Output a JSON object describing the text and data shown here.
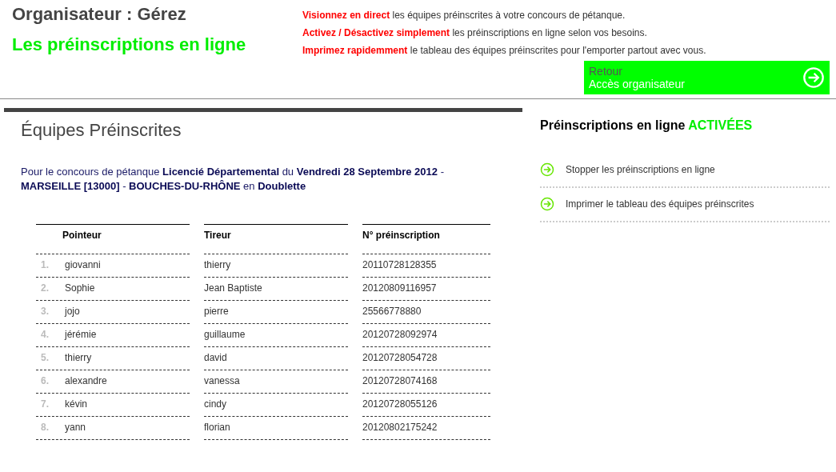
{
  "header": {
    "title": "Organisateur : Gérez",
    "subtitle": "Les préinscriptions en ligne",
    "features": [
      "**Visionnez en direct** les équipes préinscrites à votre concours de pétanque.",
      "**Activez / Désactivez simplement** les préinscriptions en ligne selon vos besoins.",
      "**Imprimez rapidemment** le tableau des équipes préinscrites pour l'emporter partout avec vous."
    ],
    "back_button": {
      "line1": "Retour",
      "line2": "Accès organisateur"
    }
  },
  "main": {
    "title": "Équipes Préinscrites",
    "description": "Pour le concours de pétanque **Licencié Départemental** du **Vendredi 28 Septembre 2012** - **MARSEILLE [13000]** - **BOUCHES-DU-RHÔNE** en **Doublette**",
    "table": {
      "columns": [
        "Pointeur",
        "Tireur",
        "N° préinscription"
      ],
      "rows": [
        {
          "number": "1.",
          "pointeur": "giovanni",
          "tireur": "thierry",
          "code": "20110728128355"
        },
        {
          "number": "2.",
          "pointeur": "Sophie",
          "tireur": "Jean Baptiste",
          "code": "20120809116957"
        },
        {
          "number": "3.",
          "pointeur": "jojo",
          "tireur": "pierre",
          "code": "25566778880"
        },
        {
          "number": "4.",
          "pointeur": "jérémie",
          "tireur": "guillaume",
          "code": "20120728092974"
        },
        {
          "number": "5.",
          "pointeur": "thierry",
          "tireur": "david",
          "code": "20120728054728"
        },
        {
          "number": "6.",
          "pointeur": "alexandre",
          "tireur": "vanessa",
          "code": "20120728074168"
        },
        {
          "number": "7.",
          "pointeur": "kévin",
          "tireur": "cindy",
          "code": "20120728055126"
        },
        {
          "number": "8.",
          "pointeur": "yann",
          "tireur": "florian",
          "code": "20120802175242"
        }
      ]
    }
  },
  "sidebar": {
    "title": "Préinscriptions en ligne",
    "status": "ACTIVÉES",
    "actions": [
      "Stopper les préinscriptions en ligne",
      "Imprimer le tableau des équipes préinscrites"
    ]
  }
}
